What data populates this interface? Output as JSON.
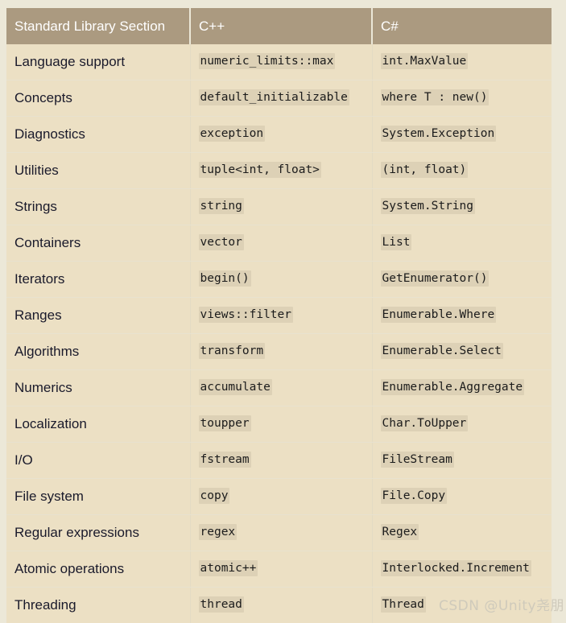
{
  "table": {
    "columns": [
      "Standard Library Section",
      "C++",
      "C#"
    ],
    "rows": [
      {
        "section": "Language support",
        "cpp": "numeric_limits::max",
        "csharp": "int.MaxValue"
      },
      {
        "section": "Concepts",
        "cpp": "default_initializable",
        "csharp": "where T : new()"
      },
      {
        "section": "Diagnostics",
        "cpp": "exception",
        "csharp": "System.Exception"
      },
      {
        "section": "Utilities",
        "cpp": "tuple<int, float>",
        "csharp": "(int, float)"
      },
      {
        "section": "Strings",
        "cpp": "string",
        "csharp": "System.String"
      },
      {
        "section": "Containers",
        "cpp": "vector",
        "csharp": "List"
      },
      {
        "section": "Iterators",
        "cpp": "begin()",
        "csharp": "GetEnumerator()"
      },
      {
        "section": "Ranges",
        "cpp": "views::filter",
        "csharp": "Enumerable.Where"
      },
      {
        "section": "Algorithms",
        "cpp": "transform",
        "csharp": "Enumerable.Select"
      },
      {
        "section": "Numerics",
        "cpp": "accumulate",
        "csharp": "Enumerable.Aggregate"
      },
      {
        "section": "Localization",
        "cpp": "toupper",
        "csharp": "Char.ToUpper"
      },
      {
        "section": "I/O",
        "cpp": "fstream",
        "csharp": "FileStream"
      },
      {
        "section": "File system",
        "cpp": "copy",
        "csharp": "File.Copy"
      },
      {
        "section": "Regular expressions",
        "cpp": "regex",
        "csharp": "Regex"
      },
      {
        "section": "Atomic operations",
        "cpp": "atomic++",
        "csharp": "Interlocked.Increment"
      },
      {
        "section": "Threading",
        "cpp": "thread",
        "csharp": "Thread"
      }
    ]
  },
  "watermark": {
    "text": "CSDN @Unity尧朋"
  },
  "colors": {
    "page_background": "#ece8d8",
    "header_background": "#ab9a80",
    "header_text": "#ffffff",
    "row_background": "#ece0c4",
    "code_chip_background": "#ddd1b6",
    "body_text": "#1a1a2b",
    "watermark_text": "#cfcabb"
  }
}
